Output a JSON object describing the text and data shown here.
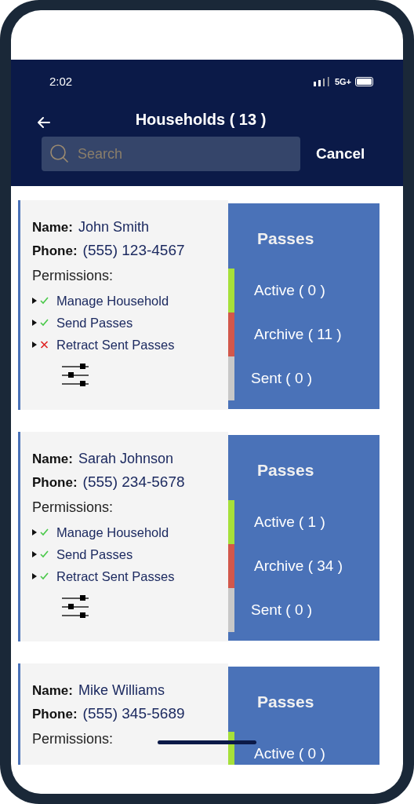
{
  "status_bar": {
    "time": "2:02",
    "network": "5G+"
  },
  "header": {
    "title": "Households ( 13 )",
    "search": {
      "placeholder": "Search"
    },
    "cancel": "Cancel"
  },
  "households": [
    {
      "name_label": "Name:",
      "name": "John Smith",
      "phone_label": "Phone:",
      "phone": "(555) 123-4567",
      "permissions_label": "Permissions:",
      "permissions": [
        {
          "label": "Manage Household",
          "allowed": true
        },
        {
          "label": "Send Passes",
          "allowed": true
        },
        {
          "label": "Retract Sent Passes",
          "allowed": false
        }
      ],
      "passes_title": "Passes",
      "passes": [
        {
          "label": "Active ( 0 )",
          "color": "#a6e03a"
        },
        {
          "label": "Archive ( 11 )",
          "color": "#d2574b"
        },
        {
          "label": "Sent ( 0 )",
          "color": "#c8c8c8"
        }
      ]
    },
    {
      "name_label": "Name:",
      "name": "Sarah Johnson",
      "phone_label": "Phone:",
      "phone": "(555) 234-5678",
      "permissions_label": "Permissions:",
      "permissions": [
        {
          "label": "Manage Household",
          "allowed": true
        },
        {
          "label": "Send Passes",
          "allowed": true
        },
        {
          "label": "Retract Sent Passes",
          "allowed": true
        }
      ],
      "passes_title": "Passes",
      "passes": [
        {
          "label": "Active ( 1 )",
          "color": "#a6e03a"
        },
        {
          "label": "Archive ( 34 )",
          "color": "#d2574b"
        },
        {
          "label": "Sent ( 0 )",
          "color": "#c8c8c8"
        }
      ]
    },
    {
      "name_label": "Name:",
      "name": "Mike Williams",
      "phone_label": "Phone:",
      "phone": "(555) 345-5689",
      "permissions_label": "Permissions:",
      "passes_title": "Passes",
      "passes": [
        {
          "label": "Active ( 0 )",
          "color": "#a6e03a"
        }
      ]
    }
  ]
}
